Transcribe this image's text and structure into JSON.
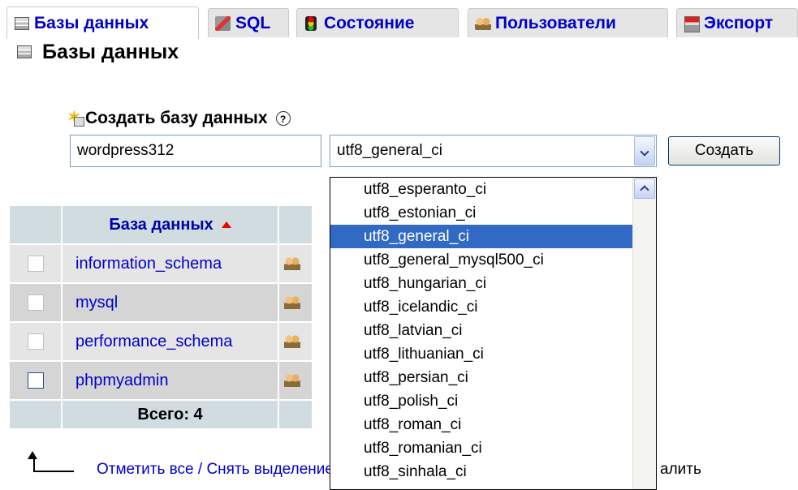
{
  "tabs": [
    {
      "label": "Базы данных",
      "icon": "database-icon",
      "active": true
    },
    {
      "label": "SQL",
      "icon": "sql-icon"
    },
    {
      "label": "Состояние",
      "icon": "status-icon"
    },
    {
      "label": "Пользователи",
      "icon": "users-icon"
    },
    {
      "label": "Экспорт",
      "icon": "export-icon"
    }
  ],
  "page": {
    "title": "Базы данных"
  },
  "create": {
    "label": "Создать базу данных",
    "help": "?",
    "name_value": "wordpress312",
    "collation_selected": "utf8_general_ci",
    "button": "Создать"
  },
  "table": {
    "header": {
      "name": "База данных"
    },
    "rows": [
      {
        "name": "information_schema"
      },
      {
        "name": "mysql"
      },
      {
        "name": "performance_schema"
      },
      {
        "name": "phpmyadmin"
      }
    ],
    "total": "Всего: 4"
  },
  "bulk": {
    "select_all": "Отметить все / Снять выделение",
    "delete_fragment": "алить"
  },
  "collation_options": [
    "utf8_esperanto_ci",
    "utf8_estonian_ci",
    "utf8_general_ci",
    "utf8_general_mysql500_ci",
    "utf8_hungarian_ci",
    "utf8_icelandic_ci",
    "utf8_latvian_ci",
    "utf8_lithuanian_ci",
    "utf8_persian_ci",
    "utf8_polish_ci",
    "utf8_roman_ci",
    "utf8_romanian_ci",
    "utf8_sinhala_ci"
  ],
  "colors": {
    "link": "#0000cc",
    "selected": "#316ac5",
    "header_bg": "#d0dce0"
  }
}
